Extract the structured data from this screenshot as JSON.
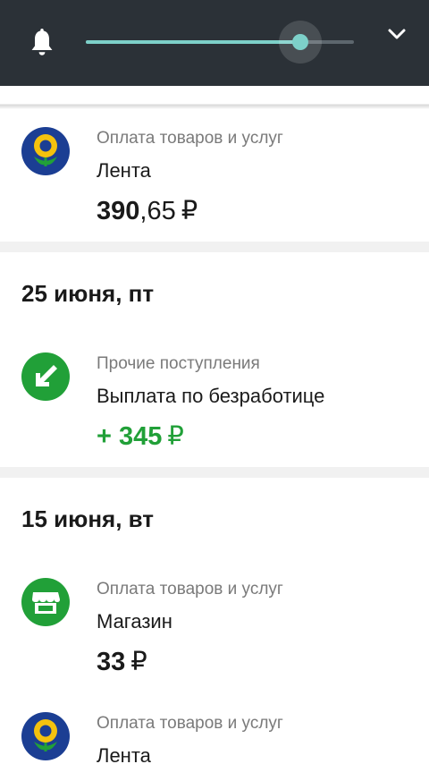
{
  "colors": {
    "topbar": "#2b3137",
    "accent": "#7dd0c9",
    "income": "#21a038",
    "separator": "#f1f1f1"
  },
  "topbar": {
    "notification_icon": "bell-icon",
    "slider_value": 0.8,
    "expand_icon": "chevron-down-icon"
  },
  "transactions": [
    {
      "category": "Оплата товаров и услуг",
      "merchant": "Лента",
      "amount_int": "390",
      "amount_frac": ",65",
      "currency": "₽",
      "icon": "lenta-logo-icon",
      "type": "expense"
    },
    {
      "date": "25 июня, пт",
      "category": "Прочие поступления",
      "merchant": "Выплата по безработице",
      "amount_int": "+ 345",
      "amount_frac": "",
      "currency": "₽",
      "icon": "income-arrow-icon",
      "type": "income"
    },
    {
      "date": "15 июня, вт",
      "category": "Оплата товаров и услуг",
      "merchant": "Магазин",
      "amount_int": "33",
      "amount_frac": "",
      "currency": "₽",
      "icon": "shop-icon",
      "type": "expense"
    },
    {
      "category": "Оплата товаров и услуг",
      "merchant": "Лента",
      "icon": "lenta-logo-icon",
      "type": "expense"
    }
  ]
}
